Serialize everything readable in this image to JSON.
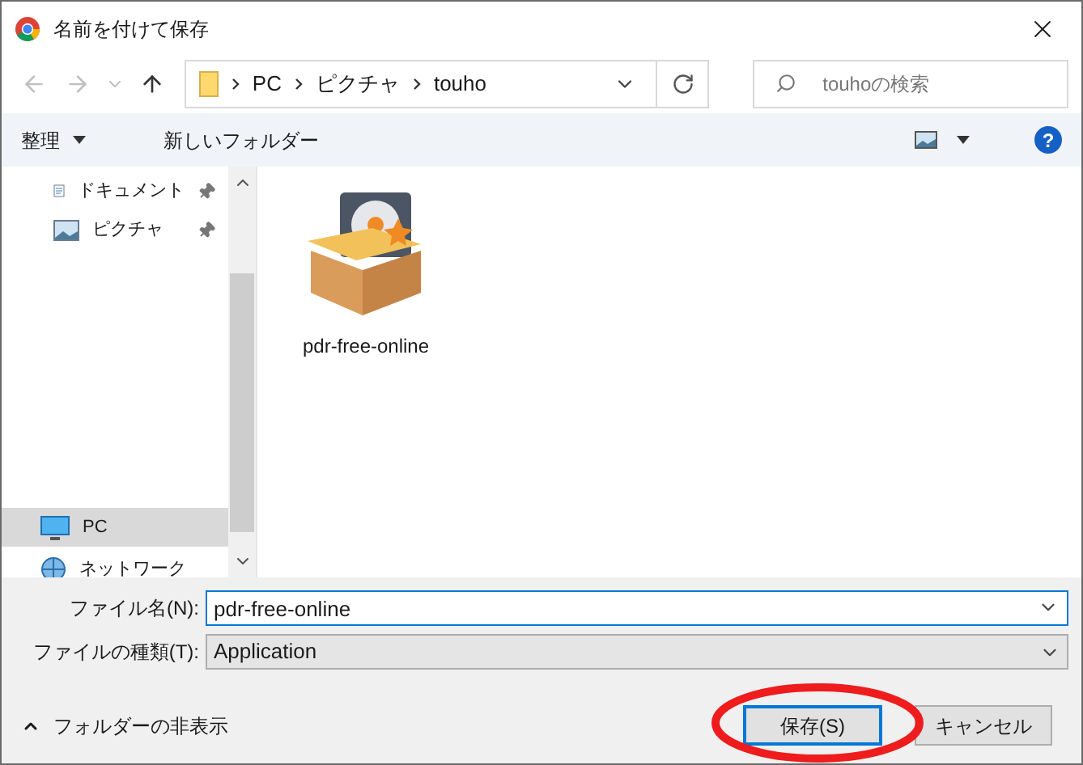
{
  "window": {
    "title": "名前を付けて保存"
  },
  "address": {
    "path": [
      "PC",
      "ピクチャ",
      "touho"
    ]
  },
  "search": {
    "placeholder": "touhoの検索"
  },
  "toolbar": {
    "organize": "整理",
    "new_folder": "新しいフォルダー",
    "help": "?"
  },
  "sidebar": {
    "items": [
      {
        "label": "ドキュメント",
        "kind": "document",
        "pinned": true,
        "selected": false
      },
      {
        "label": "ピクチャ",
        "kind": "pictures",
        "pinned": true,
        "selected": false
      },
      {
        "label": "PC",
        "kind": "pc",
        "pinned": false,
        "selected": true
      },
      {
        "label": "ネットワーク",
        "kind": "network",
        "pinned": false,
        "selected": false
      }
    ]
  },
  "files": [
    {
      "name": "pdr-free-online"
    }
  ],
  "file_name": {
    "label": "ファイル名(N):",
    "value": "pdr-free-online"
  },
  "file_type": {
    "label": "ファイルの種類(T):",
    "value": "Application"
  },
  "hide_folders": "フォルダーの非表示",
  "buttons": [
    {
      "label": "保存(S)",
      "kind": "primary"
    },
    {
      "label": "キャンセル",
      "kind": "secondary"
    }
  ]
}
